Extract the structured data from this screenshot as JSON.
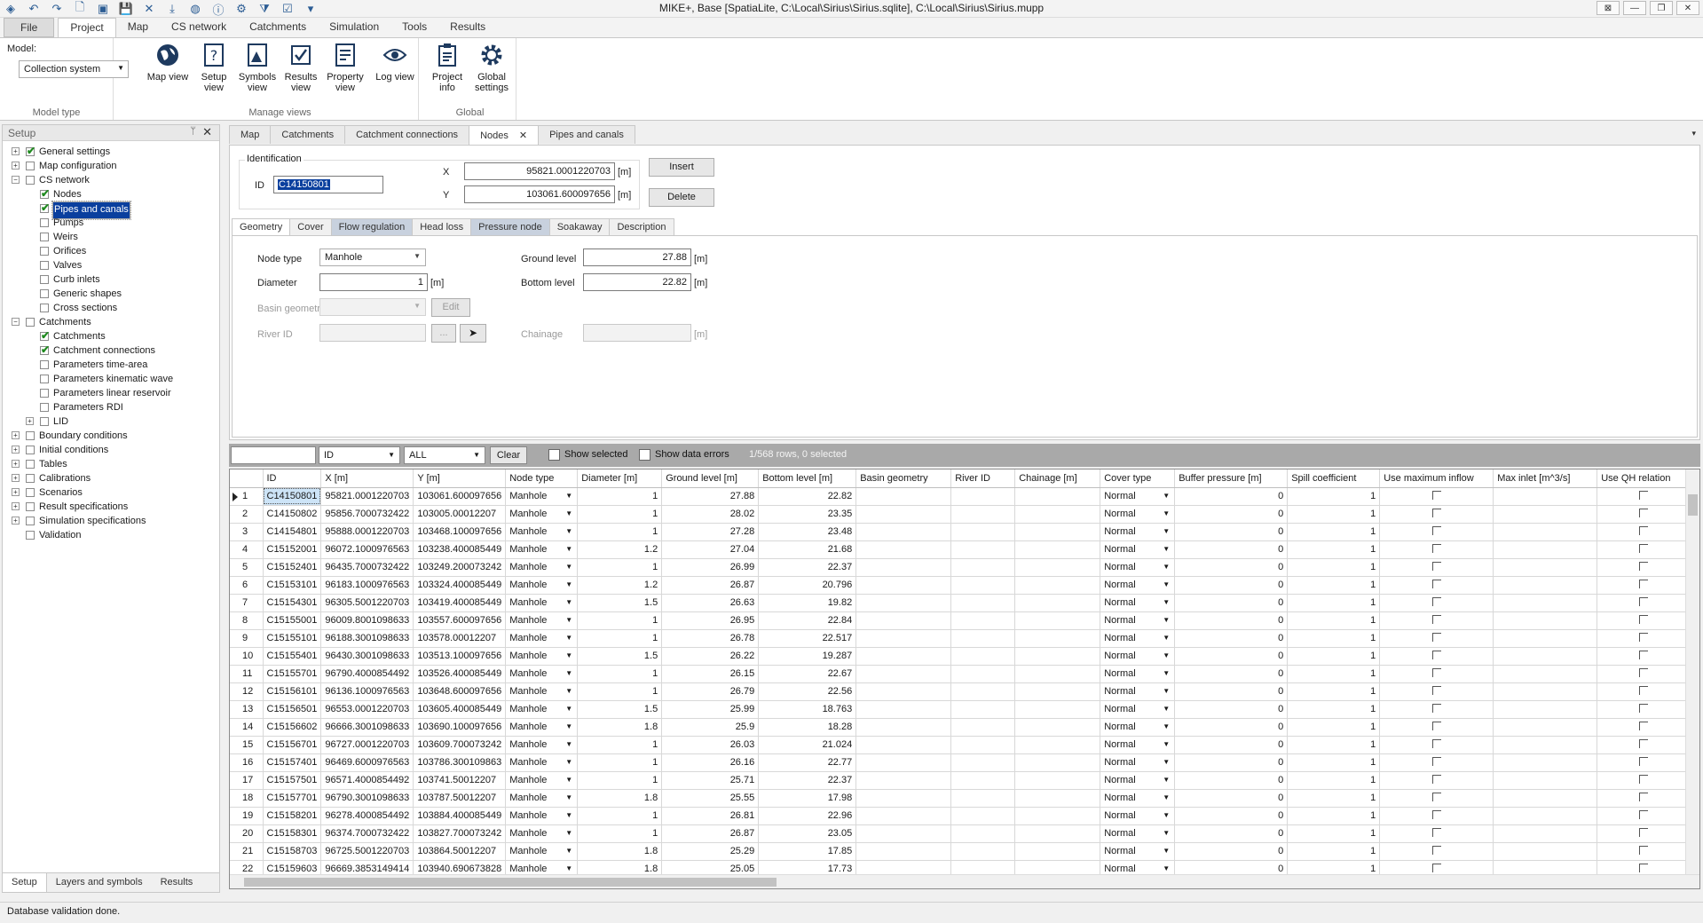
{
  "window": {
    "title": "MIKE+, Base [SpatiaLite, C:\\Local\\Sirius\\Sirius.sqlite], C:\\Local\\Sirius\\Sirius.mupp",
    "buttons": [
      "⊠",
      "—",
      "❐",
      "✕"
    ]
  },
  "qat_icons": [
    "app-logo-icon",
    "undo-icon",
    "redo-icon",
    "new-file-icon",
    "open-icon",
    "save-icon",
    "close-file-icon",
    "import-icon",
    "globe-icon",
    "info-icon",
    "validate-icon",
    "filter-icon",
    "check-icon",
    "dropdown-icon"
  ],
  "ribbon_tabs": [
    "File",
    "Project",
    "Map",
    "CS network",
    "Catchments",
    "Simulation",
    "Tools",
    "Results"
  ],
  "ribbon": {
    "model_label": "Model:",
    "model_value": "Collection system",
    "groups": {
      "model_type": "Model type",
      "manage_views": "Manage views",
      "global": "Global"
    },
    "buttons": {
      "map_view": "Map view",
      "setup_view": "Setup view",
      "symbols_view": "Symbols view",
      "results_view": "Results view",
      "property_view": "Property view",
      "log_view": "Log view",
      "project_info": "Project info",
      "global_settings": "Global settings"
    }
  },
  "setup_panel": {
    "title": "Setup",
    "pin": "ᛘ",
    "close": "✕",
    "bottom_tabs": [
      "Setup",
      "Layers and symbols",
      "Results"
    ]
  },
  "tree": [
    {
      "label": "General settings",
      "level": 0,
      "exp": "+",
      "checked": true
    },
    {
      "label": "Map configuration",
      "level": 0,
      "exp": "+",
      "checked": false
    },
    {
      "label": "CS network",
      "level": 0,
      "exp": "−",
      "checked": false
    },
    {
      "label": "Nodes",
      "level": 1,
      "exp": "",
      "checked": true
    },
    {
      "label": "Pipes and canals",
      "level": 1,
      "exp": "",
      "checked": true,
      "selected": true
    },
    {
      "label": "Pumps",
      "level": 1,
      "exp": "",
      "checked": false
    },
    {
      "label": "Weirs",
      "level": 1,
      "exp": "",
      "checked": false
    },
    {
      "label": "Orifices",
      "level": 1,
      "exp": "",
      "checked": false
    },
    {
      "label": "Valves",
      "level": 1,
      "exp": "",
      "checked": false
    },
    {
      "label": "Curb inlets",
      "level": 1,
      "exp": "",
      "checked": false
    },
    {
      "label": "Generic shapes",
      "level": 1,
      "exp": "",
      "checked": false
    },
    {
      "label": "Cross sections",
      "level": 1,
      "exp": "",
      "checked": false
    },
    {
      "label": "Catchments",
      "level": 0,
      "exp": "−",
      "checked": false
    },
    {
      "label": "Catchments",
      "level": 1,
      "exp": "",
      "checked": true
    },
    {
      "label": "Catchment connections",
      "level": 1,
      "exp": "",
      "checked": true
    },
    {
      "label": "Parameters time-area",
      "level": 1,
      "exp": "",
      "checked": false
    },
    {
      "label": "Parameters kinematic wave",
      "level": 1,
      "exp": "",
      "checked": false
    },
    {
      "label": "Parameters linear reservoir",
      "level": 1,
      "exp": "",
      "checked": false
    },
    {
      "label": "Parameters RDI",
      "level": 1,
      "exp": "",
      "checked": false
    },
    {
      "label": "LID",
      "level": 1,
      "exp": "+",
      "checked": false
    },
    {
      "label": "Boundary conditions",
      "level": 0,
      "exp": "+",
      "checked": false
    },
    {
      "label": "Initial conditions",
      "level": 0,
      "exp": "+",
      "checked": false
    },
    {
      "label": "Tables",
      "level": 0,
      "exp": "+",
      "checked": false
    },
    {
      "label": "Calibrations",
      "level": 0,
      "exp": "+",
      "checked": false
    },
    {
      "label": "Scenarios",
      "level": 0,
      "exp": "+",
      "checked": false
    },
    {
      "label": "Result specifications",
      "level": 0,
      "exp": "+",
      "checked": false
    },
    {
      "label": "Simulation specifications",
      "level": 0,
      "exp": "+",
      "checked": false
    },
    {
      "label": "Validation",
      "level": 0,
      "exp": "",
      "checked": false
    }
  ],
  "doc_tabs": [
    {
      "label": "Map",
      "active": false
    },
    {
      "label": "Catchments",
      "active": false
    },
    {
      "label": "Catchment connections",
      "active": false
    },
    {
      "label": "Nodes",
      "active": true
    },
    {
      "label": "Pipes and canals",
      "active": false
    }
  ],
  "doc_tab_close": "✕",
  "doc_menu": "▾",
  "identification": {
    "title": "Identification",
    "id_label": "ID",
    "id_value": "C14150801",
    "x_label": "X",
    "x_value": "95821.0001220703",
    "y_label": "Y",
    "y_value": "103061.600097656",
    "unit": "[m]",
    "insert": "Insert",
    "delete": "Delete"
  },
  "sub_tabs": [
    "Geometry",
    "Cover",
    "Flow regulation",
    "Head loss",
    "Pressure node",
    "Soakaway",
    "Description"
  ],
  "geometry": {
    "node_type_label": "Node type",
    "node_type_value": "Manhole",
    "diameter_label": "Diameter",
    "diameter_value": "1",
    "basin_label": "Basin geometry",
    "edit": "Edit",
    "river_label": "River ID",
    "ellipsis": "...",
    "ground_label": "Ground level",
    "ground_value": "27.88",
    "bottom_label": "Bottom level",
    "bottom_value": "22.82",
    "chainage_label": "Chainage",
    "unit": "[m]"
  },
  "filter": {
    "search_value": "",
    "field_value": "ID",
    "op_value": "ALL",
    "clear": "Clear",
    "show_selected": "Show selected",
    "show_errors": "Show data errors",
    "row_info": "1/568 rows, 0 selected"
  },
  "grid": {
    "columns": [
      "",
      "ID",
      "X [m]",
      "Y [m]",
      "Node type",
      "Diameter [m]",
      "Ground level [m]",
      "Bottom level [m]",
      "Basin geometry",
      "River ID",
      "Chainage [m]",
      "Cover type",
      "Buffer pressure [m]",
      "Spill coefficient",
      "Use maximum inflow",
      "Max inlet [m^3/s]",
      "Use QH relation"
    ],
    "rows": [
      [
        "1",
        "C14150801",
        "95821.0001220703",
        "103061.600097656",
        "Manhole",
        "1",
        "27.88",
        "22.82",
        "",
        "",
        "",
        "Normal",
        "0",
        "1"
      ],
      [
        "2",
        "C14150802",
        "95856.7000732422",
        "103005.00012207",
        "Manhole",
        "1",
        "28.02",
        "23.35",
        "",
        "",
        "",
        "Normal",
        "0",
        "1"
      ],
      [
        "3",
        "C14154801",
        "95888.0001220703",
        "103468.100097656",
        "Manhole",
        "1",
        "27.28",
        "23.48",
        "",
        "",
        "",
        "Normal",
        "0",
        "1"
      ],
      [
        "4",
        "C15152001",
        "96072.1000976563",
        "103238.400085449",
        "Manhole",
        "1.2",
        "27.04",
        "21.68",
        "",
        "",
        "",
        "Normal",
        "0",
        "1"
      ],
      [
        "5",
        "C15152401",
        "96435.7000732422",
        "103249.200073242",
        "Manhole",
        "1",
        "26.99",
        "22.37",
        "",
        "",
        "",
        "Normal",
        "0",
        "1"
      ],
      [
        "6",
        "C15153101",
        "96183.1000976563",
        "103324.400085449",
        "Manhole",
        "1.2",
        "26.87",
        "20.796",
        "",
        "",
        "",
        "Normal",
        "0",
        "1"
      ],
      [
        "7",
        "C15154301",
        "96305.5001220703",
        "103419.400085449",
        "Manhole",
        "1.5",
        "26.63",
        "19.82",
        "",
        "",
        "",
        "Normal",
        "0",
        "1"
      ],
      [
        "8",
        "C15155001",
        "96009.8001098633",
        "103557.600097656",
        "Manhole",
        "1",
        "26.95",
        "22.84",
        "",
        "",
        "",
        "Normal",
        "0",
        "1"
      ],
      [
        "9",
        "C15155101",
        "96188.3001098633",
        "103578.00012207",
        "Manhole",
        "1",
        "26.78",
        "22.517",
        "",
        "",
        "",
        "Normal",
        "0",
        "1"
      ],
      [
        "10",
        "C15155401",
        "96430.3001098633",
        "103513.100097656",
        "Manhole",
        "1.5",
        "26.22",
        "19.287",
        "",
        "",
        "",
        "Normal",
        "0",
        "1"
      ],
      [
        "11",
        "C15155701",
        "96790.4000854492",
        "103526.400085449",
        "Manhole",
        "1",
        "26.15",
        "22.67",
        "",
        "",
        "",
        "Normal",
        "0",
        "1"
      ],
      [
        "12",
        "C15156101",
        "96136.1000976563",
        "103648.600097656",
        "Manhole",
        "1",
        "26.79",
        "22.56",
        "",
        "",
        "",
        "Normal",
        "0",
        "1"
      ],
      [
        "13",
        "C15156501",
        "96553.0001220703",
        "103605.400085449",
        "Manhole",
        "1.5",
        "25.99",
        "18.763",
        "",
        "",
        "",
        "Normal",
        "0",
        "1"
      ],
      [
        "14",
        "C15156602",
        "96666.3001098633",
        "103690.100097656",
        "Manhole",
        "1.8",
        "25.9",
        "18.28",
        "",
        "",
        "",
        "Normal",
        "0",
        "1"
      ],
      [
        "15",
        "C15156701",
        "96727.0001220703",
        "103609.700073242",
        "Manhole",
        "1",
        "26.03",
        "21.024",
        "",
        "",
        "",
        "Normal",
        "0",
        "1"
      ],
      [
        "16",
        "C15157401",
        "96469.6000976563",
        "103786.300109863",
        "Manhole",
        "1",
        "26.16",
        "22.77",
        "",
        "",
        "",
        "Normal",
        "0",
        "1"
      ],
      [
        "17",
        "C15157501",
        "96571.4000854492",
        "103741.50012207",
        "Manhole",
        "1",
        "25.71",
        "22.37",
        "",
        "",
        "",
        "Normal",
        "0",
        "1"
      ],
      [
        "18",
        "C15157701",
        "96790.3001098633",
        "103787.50012207",
        "Manhole",
        "1.8",
        "25.55",
        "17.98",
        "",
        "",
        "",
        "Normal",
        "0",
        "1"
      ],
      [
        "19",
        "C15158201",
        "96278.4000854492",
        "103884.400085449",
        "Manhole",
        "1",
        "26.81",
        "22.96",
        "",
        "",
        "",
        "Normal",
        "0",
        "1"
      ],
      [
        "20",
        "C15158301",
        "96374.7000732422",
        "103827.700073242",
        "Manhole",
        "1",
        "26.87",
        "23.05",
        "",
        "",
        "",
        "Normal",
        "0",
        "1"
      ],
      [
        "21",
        "C15158703",
        "96725.5001220703",
        "103864.50012207",
        "Manhole",
        "1.8",
        "25.29",
        "17.85",
        "",
        "",
        "",
        "Normal",
        "0",
        "1"
      ],
      [
        "22",
        "C15159603",
        "96669.3853149414",
        "103940.690673828",
        "Manhole",
        "1.8",
        "25.05",
        "17.73",
        "",
        "",
        "",
        "Normal",
        "0",
        "1"
      ]
    ]
  },
  "status": "Database validation done."
}
